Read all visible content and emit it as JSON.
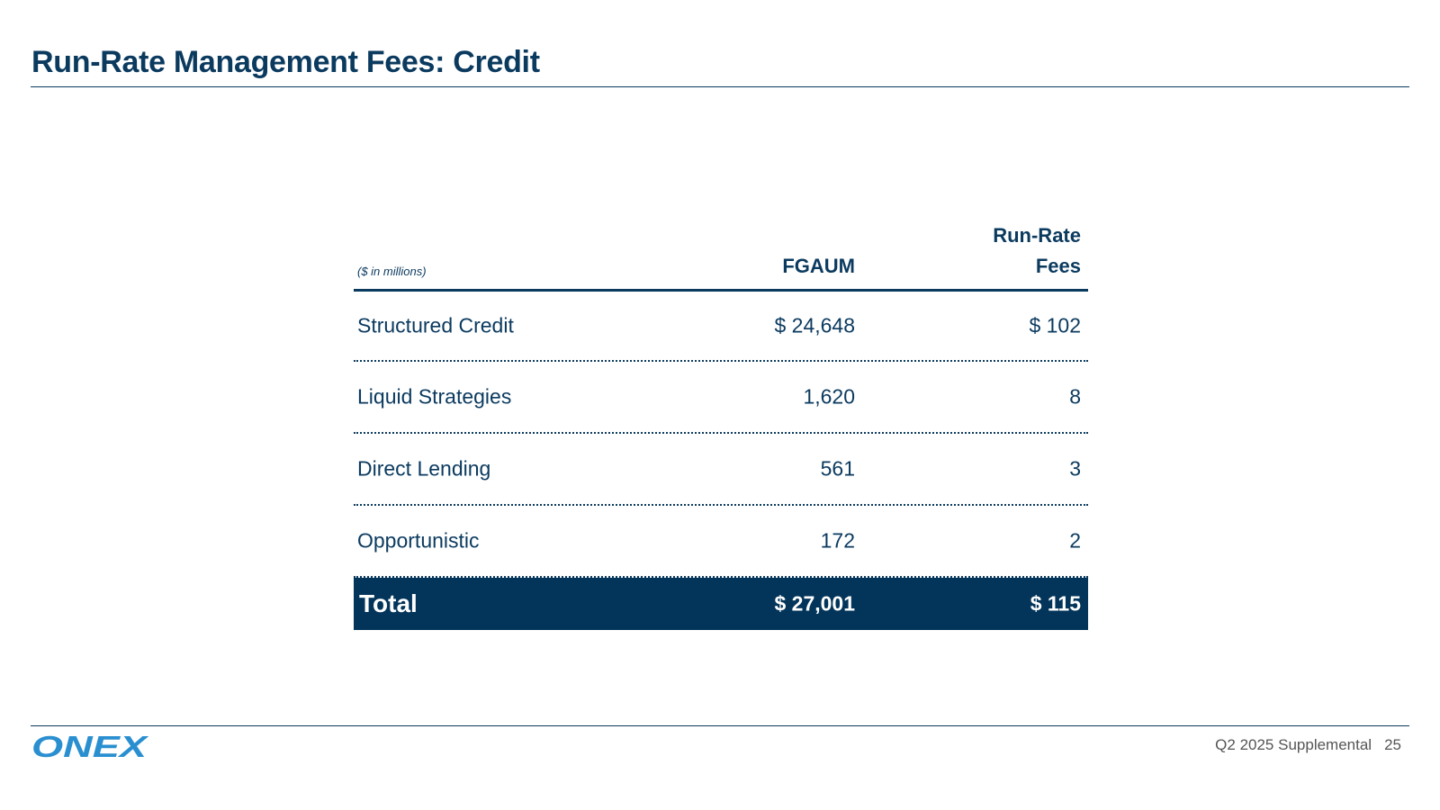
{
  "header": {
    "title": "Run-Rate Management Fees: Credit"
  },
  "table": {
    "units": "($ in millions)",
    "columns": {
      "fgaum": "FGAUM",
      "fees_line1": "Run-Rate",
      "fees_line2": "Fees"
    },
    "rows": [
      {
        "label": "Structured Credit",
        "fgaum": "$ 24,648",
        "fees": "$ 102"
      },
      {
        "label": "Liquid Strategies",
        "fgaum": "1,620",
        "fees": "8"
      },
      {
        "label": "Direct Lending",
        "fgaum": "561",
        "fees": "3"
      },
      {
        "label": "Opportunistic",
        "fgaum": "172",
        "fees": "2"
      }
    ],
    "total": {
      "label": "Total",
      "fgaum": "$ 27,001",
      "fees": "$ 115"
    }
  },
  "footer": {
    "logo_text": "ONEX",
    "doc_label": "Q2 2025 Supplemental",
    "page_number": "25",
    "logo_color": "#2a8fd0"
  },
  "colors": {
    "navy": "#0b3a5f",
    "total_bg": "#03355a"
  }
}
